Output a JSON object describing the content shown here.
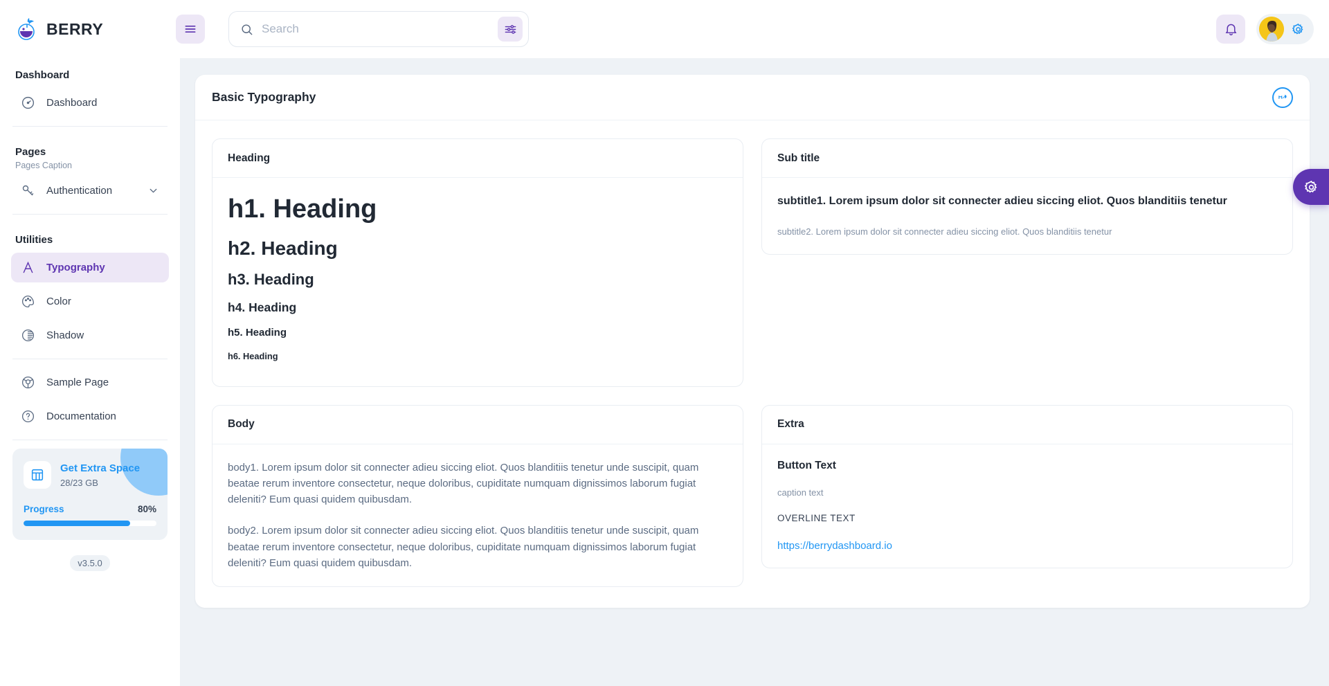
{
  "brand": {
    "name": "BERRY",
    "logo_icon": "berry-logo-icon"
  },
  "header": {
    "menu_toggle_icon": "hamburger-menu-icon",
    "search": {
      "placeholder": "Search",
      "value": "",
      "icon": "search-icon",
      "filter_icon": "filter-sliders-icon"
    },
    "notification_icon": "bell-icon",
    "avatar_icon": "user-avatar",
    "settings_icon": "gear-icon"
  },
  "sidebar": {
    "sections": [
      {
        "caption": "Dashboard",
        "subcaption": ""
      },
      {
        "caption": "Pages",
        "subcaption": "Pages Caption"
      },
      {
        "caption": "Utilities",
        "subcaption": ""
      }
    ],
    "dashboard_item": {
      "label": "Dashboard",
      "icon": "speedometer-icon"
    },
    "authentication_item": {
      "label": "Authentication",
      "icon": "key-icon",
      "chevron": "chevron-down-icon"
    },
    "utilities_items": [
      {
        "label": "Typography",
        "icon": "typography-a-icon",
        "active": true
      },
      {
        "label": "Color",
        "icon": "color-palette-icon",
        "active": false
      },
      {
        "label": "Shadow",
        "icon": "shadow-circle-icon",
        "active": false
      }
    ],
    "other_items": [
      {
        "label": "Sample Page",
        "icon": "chrome-circle-icon"
      },
      {
        "label": "Documentation",
        "icon": "question-circle-icon"
      }
    ],
    "upgrade": {
      "icon": "storage-table-icon",
      "title": "Get Extra Space",
      "subtitle": "28/23 GB",
      "progress_label": "Progress",
      "progress_value": "80%",
      "progress_percent": 80
    },
    "version": "v3.5.0"
  },
  "main": {
    "page_title": "Basic Typography",
    "mui_badge_icon": "mui-logo-icon",
    "cards": {
      "heading": {
        "title": "Heading",
        "h1": "h1. Heading",
        "h2": "h2. Heading",
        "h3": "h3. Heading",
        "h4": "h4. Heading",
        "h5": "h5. Heading",
        "h6": "h6. Heading"
      },
      "subtitle": {
        "title": "Sub title",
        "subtitle1": "subtitle1. Lorem ipsum dolor sit connecter adieu siccing eliot. Quos blanditiis tenetur",
        "subtitle2": "subtitle2. Lorem ipsum dolor sit connecter adieu siccing eliot. Quos blanditiis tenetur"
      },
      "body": {
        "title": "Body",
        "body1": "body1. Lorem ipsum dolor sit connecter adieu siccing eliot. Quos blanditiis tenetur unde suscipit, quam beatae rerum inventore consectetur, neque doloribus, cupiditate numquam dignissimos laborum fugiat deleniti? Eum quasi quidem quibusdam.",
        "body2": "body2. Lorem ipsum dolor sit connecter adieu siccing eliot. Quos blanditiis tenetur unde suscipit, quam beatae rerum inventore consectetur, neque doloribus, cupiditate numquam dignissimos laborum fugiat deleniti? Eum quasi quidem quibusdam."
      },
      "extra": {
        "title": "Extra",
        "button_text": "Button Text",
        "caption_text": "caption text",
        "overline_text": "OVERLINE TEXT",
        "link_text": "https://berrydashboard.io"
      }
    }
  },
  "fab": {
    "icon": "gear-icon"
  },
  "colors": {
    "primary": "#5e35b1",
    "primary_light": "#ede7f6",
    "secondary_blue": "#2196f3",
    "page_bg": "#eef2f6",
    "text_dark": "#212934",
    "text_muted": "#8492a6"
  }
}
